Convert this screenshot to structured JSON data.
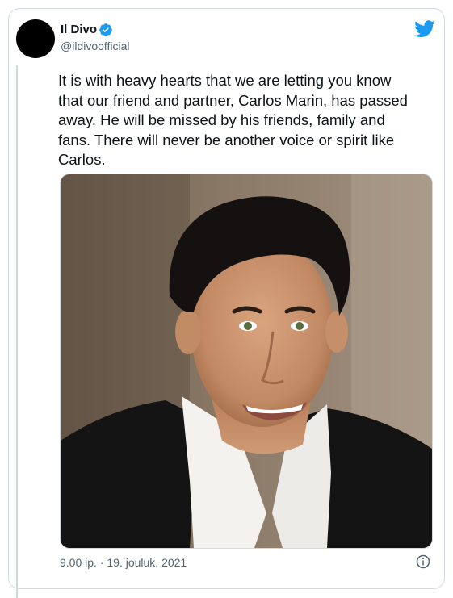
{
  "tweet": {
    "display_name": "Il Divo",
    "handle": "@ildivoofficial",
    "text": "It is with heavy hearts that we are letting you know\nthat our friend and partner, Carlos Marin, has passed\naway. He will be missed by his friends, family and\nfans.  There will never be another voice or spirit like\nCarlos.",
    "timestamp": "9.00 ip. · 19. jouluk. 2021",
    "verified_icon": "verified-badge-icon",
    "platform_icon": "twitter-bird-icon",
    "info_icon": "info-icon",
    "photo_subject": "portrait-photo"
  },
  "colors": {
    "twitter_blue": "#1d9bf0",
    "text_primary": "#0f1419",
    "text_secondary": "#536471",
    "border": "#cfd9de"
  }
}
